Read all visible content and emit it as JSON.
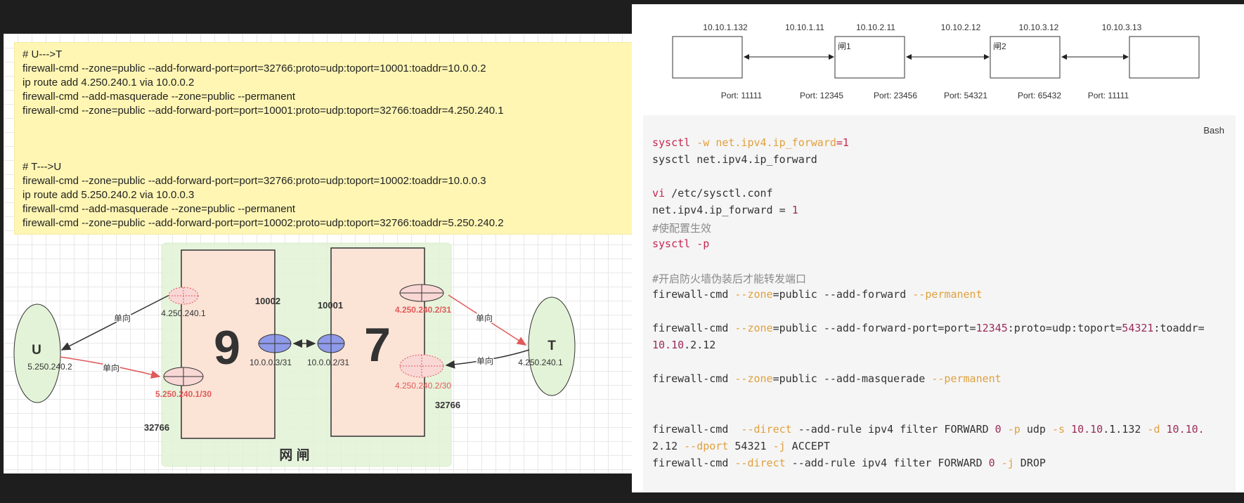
{
  "note": {
    "lines": [
      "# U--->T",
      "firewall-cmd --zone=public --add-forward-port=port=32766:proto=udp:toport=10001:toaddr=10.0.0.2",
      "ip route add 4.250.240.1 via 10.0.0.2",
      "firewall-cmd --add-masquerade --zone=public --permanent",
      "firewall-cmd --zone=public --add-forward-port=port=10001:proto=udp:toport=32766:toaddr=4.250.240.1",
      "# T--->U",
      "firewall-cmd --zone=public --add-forward-port=port=32766:proto=udp:toport=10002:toaddr=10.0.0.3",
      "ip route add 5.250.240.2 via 10.0.0.3",
      "firewall-cmd --add-masquerade --zone=public --permanent",
      "firewall-cmd --zone=public --add-forward-port=port=10002:proto=udp:toport=32766:toaddr=5.250.240.2"
    ]
  },
  "diagram": {
    "node_u": "U",
    "node_u_ip": "5.250.240.2",
    "node_t": "T",
    "node_t_ip": "4.250.240.1",
    "box9": "9",
    "box7": "7",
    "gateway_label": "网 闸",
    "oneway": "单向",
    "ip_9_top": "4.250.240.1",
    "ip_9_bottom": "5.250.240.1/30",
    "ip_9_right": "10.0.0.3/31",
    "ip_7_left": "10.0.0.2/31",
    "ip_7_top": "4.250.240.2/31",
    "ip_7_bottom": "4.250.240.2/30",
    "port_10002": "10002",
    "port_10001": "10001",
    "port_32766_a": "32766",
    "port_32766_b": "32766",
    "colors": {
      "red": "#e05a5a",
      "blue": "#6f7fe0",
      "pink": "#f8d7d5",
      "peach": "#fbe3d6",
      "green": "#e3f3d7"
    }
  },
  "topology": {
    "ips": [
      "10.10.1.132",
      "10.10.1.11",
      "10.10.2.11",
      "10.10.2.12",
      "10.10.3.12",
      "10.10.3.13"
    ],
    "box_labels": [
      "闸1",
      "闸2"
    ],
    "ports": [
      "Port: 11111",
      "Port: 12345",
      "Port: 23456",
      "Port: 54321",
      "Port: 65432",
      "Port: 11111"
    ]
  },
  "code": {
    "language": "Bash",
    "l1a": "sysctl",
    "l1b": " -w ",
    "l1c": "net.ipv4.ip_forward",
    "l1d": "=1",
    "l2": "sysctl net.ipv4.ip_forward",
    "l3a": "vi",
    "l3b": " /etc/sysctl.conf",
    "l4a": "net.ipv4.ip_forward = ",
    "l4b": "1",
    "l5": "#使配置生效",
    "l6": "sysctl -p",
    "l7": "#开启防火墙伪装后才能转发端口",
    "l8a": "firewall-cmd ",
    "l8b": "--zone",
    "l8c": "=public --add-forward ",
    "l8d": "--permanent",
    "l9a": "firewall-cmd ",
    "l9b": "--zone",
    "l9c": "=public --add-forward-port=port=",
    "l9d": "12345",
    "l9e": ":proto=udp:toport=",
    "l9f": "54321",
    "l9g": ":toaddr=",
    "l10a": "10.10",
    "l10b": ".2.12",
    "l11a": "firewall-cmd ",
    "l11b": "--zone",
    "l11c": "=public --add-masquerade ",
    "l11d": "--permanent",
    "l12a": "firewall-cmd  ",
    "l12b": "--direct",
    "l12c": " --add-rule ipv4 filter FORWARD ",
    "l12d": "0",
    "l12e": " -p",
    "l12f": " udp ",
    "l12g": "-s",
    "l12h": " 10.10",
    "l12i": ".1.132 ",
    "l12j": "-d",
    "l12k": " 10.10.",
    "l13a": "2.12 ",
    "l13b": "--dport",
    "l13c": " 54321 ",
    "l13d": "-j",
    "l13e": " ACCEPT",
    "l14a": "firewall-cmd ",
    "l14b": "--direct",
    "l14c": " --add-rule ipv4 filter FORWARD ",
    "l14d": "0",
    "l14e": " -j",
    "l14f": " DROP"
  }
}
